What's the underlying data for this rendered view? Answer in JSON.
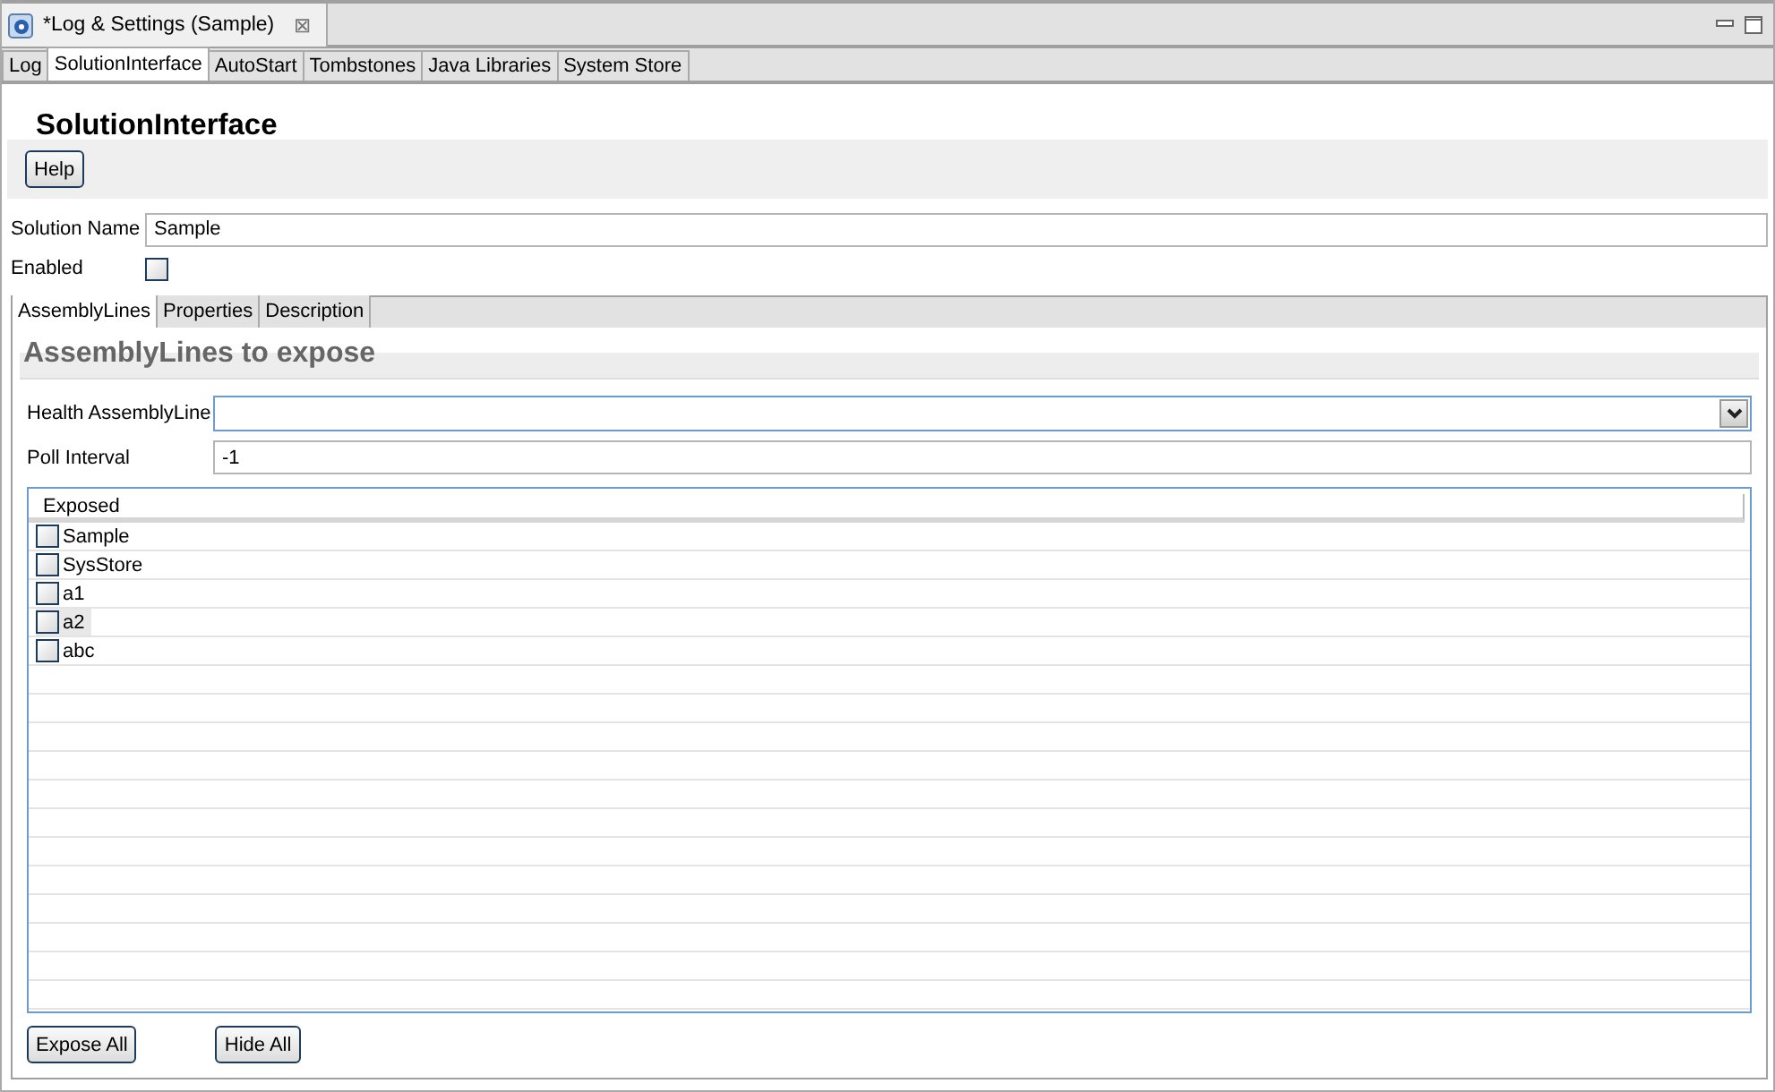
{
  "editor_tab": {
    "title": "*Log & Settings (Sample)",
    "close": "⊠"
  },
  "tabs": [
    {
      "label": "Log",
      "selected": false
    },
    {
      "label": "SolutionInterface",
      "selected": true
    },
    {
      "label": "AutoStart",
      "selected": false
    },
    {
      "label": "Tombstones",
      "selected": false
    },
    {
      "label": "Java Libraries",
      "selected": false
    },
    {
      "label": "System Store",
      "selected": false
    }
  ],
  "heading": "SolutionInterface",
  "help_button": "Help",
  "solution_name": {
    "label": "Solution Name",
    "value": "Sample"
  },
  "enabled": {
    "label": "Enabled",
    "checked": false
  },
  "inner_tabs": [
    {
      "label": "AssemblyLines",
      "selected": true
    },
    {
      "label": "Properties",
      "selected": false
    },
    {
      "label": "Description",
      "selected": false
    }
  ],
  "section_title": "AssemblyLines to expose",
  "health_assemblyline": {
    "label": "Health AssemblyLine"
  },
  "poll_interval": {
    "label": "Poll Interval",
    "value": "-1"
  },
  "table": {
    "columns": [
      "Exposed"
    ],
    "rows": [
      {
        "name": "Sample",
        "checked": false,
        "selected": false
      },
      {
        "name": "SysStore",
        "checked": false,
        "selected": false
      },
      {
        "name": "a1",
        "checked": false,
        "selected": false
      },
      {
        "name": "a2",
        "checked": false,
        "selected": true
      },
      {
        "name": "abc",
        "checked": false,
        "selected": false
      }
    ]
  },
  "buttons": [
    "Expose All",
    "Hide All"
  ]
}
